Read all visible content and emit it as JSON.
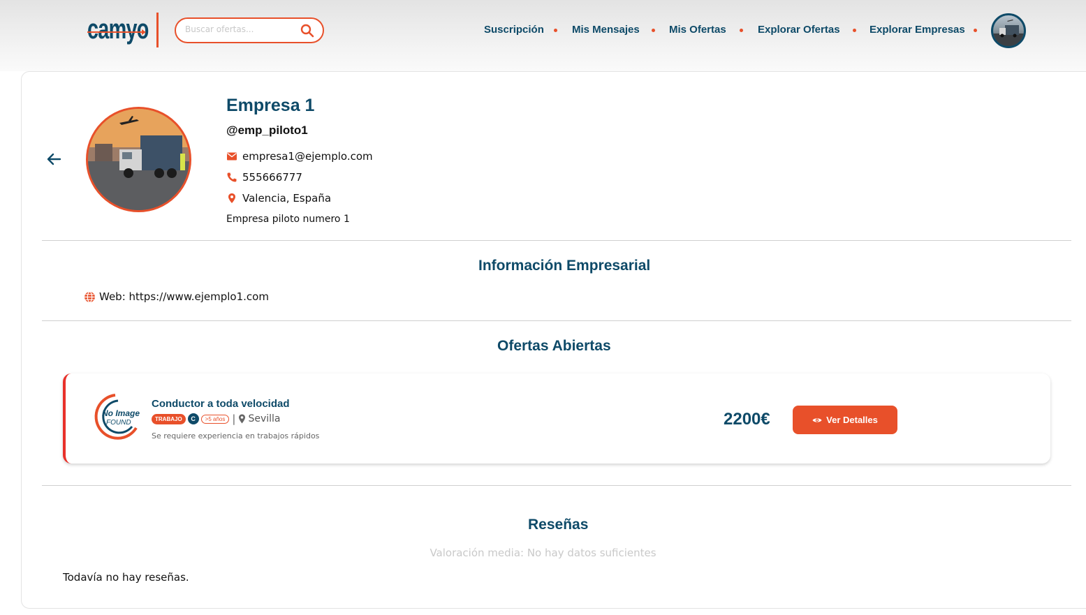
{
  "header": {
    "logo_text": "camyo",
    "search_placeholder": "Buscar ofertas...",
    "nav": [
      "Suscripción",
      "Mis Mensajes",
      "Mis Ofertas",
      "Explorar Ofertas",
      "Explorar Empresas"
    ]
  },
  "profile": {
    "name": "Empresa 1",
    "username": "@emp_piloto1",
    "email": "empresa1@ejemplo.com",
    "phone": "555666777",
    "location": "Valencia, España",
    "description": "Empresa piloto numero 1"
  },
  "business_info": {
    "title": "Información Empresarial",
    "web": "Web: https://www.ejemplo1.com"
  },
  "offers": {
    "title": "Ofertas Abiertas",
    "items": [
      {
        "title": "Conductor a toda velocidad",
        "type_tag": "TRABAJO",
        "license": "C",
        "experience": ">5 años",
        "separator": "|",
        "location": "Sevilla",
        "description": "Se requiere experiencia en trabajos rápidos",
        "price": "2200€",
        "button_label": "Ver Detalles",
        "image_text_1": "No Image",
        "image_text_2": "FOUND"
      }
    ]
  },
  "reviews": {
    "title": "Reseñas",
    "rating_text": "Valoración media: No hay datos suficientes",
    "empty_text": "Todavía no hay reseñas."
  },
  "colors": {
    "primary": "#0e4a68",
    "accent": "#e8502a",
    "offer_border": "#e8312a"
  }
}
